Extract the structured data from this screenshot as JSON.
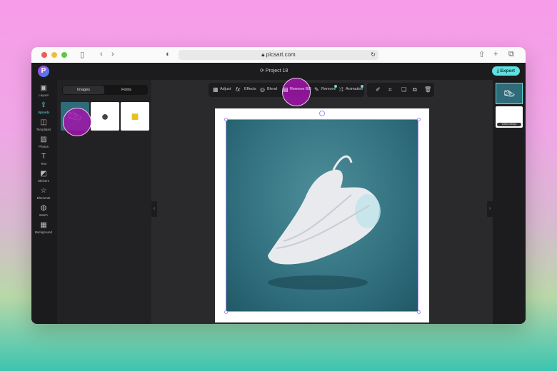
{
  "browser": {
    "url": "picsart.com"
  },
  "app": {
    "logo": "P",
    "project_title": "Project 18",
    "export_label": "Export"
  },
  "nav": [
    {
      "label": "Layout",
      "icon": "▣"
    },
    {
      "label": "Uploads",
      "icon": "⇪"
    },
    {
      "label": "Templates",
      "icon": "◫"
    },
    {
      "label": "Photos",
      "icon": "▨"
    },
    {
      "label": "Text",
      "icon": "T"
    },
    {
      "label": "Stickers",
      "icon": "◩"
    },
    {
      "label": "Elements",
      "icon": "☆"
    },
    {
      "label": "Batch",
      "icon": "◍"
    },
    {
      "label": "Background",
      "icon": "▦"
    }
  ],
  "panel": {
    "tabs": [
      "Images",
      "Fonts"
    ],
    "active_tab": "Images"
  },
  "toolbar": {
    "adjust": "Adjust",
    "effects": "Effects",
    "blend": "Blend",
    "remove_bg": "Remove BG",
    "remove": "Remove",
    "animation": "Animation"
  },
  "pages": {
    "page2_size": "1080x1080px"
  },
  "colors": {
    "accent": "#5ee0e0",
    "highlight": "#a014aa"
  }
}
